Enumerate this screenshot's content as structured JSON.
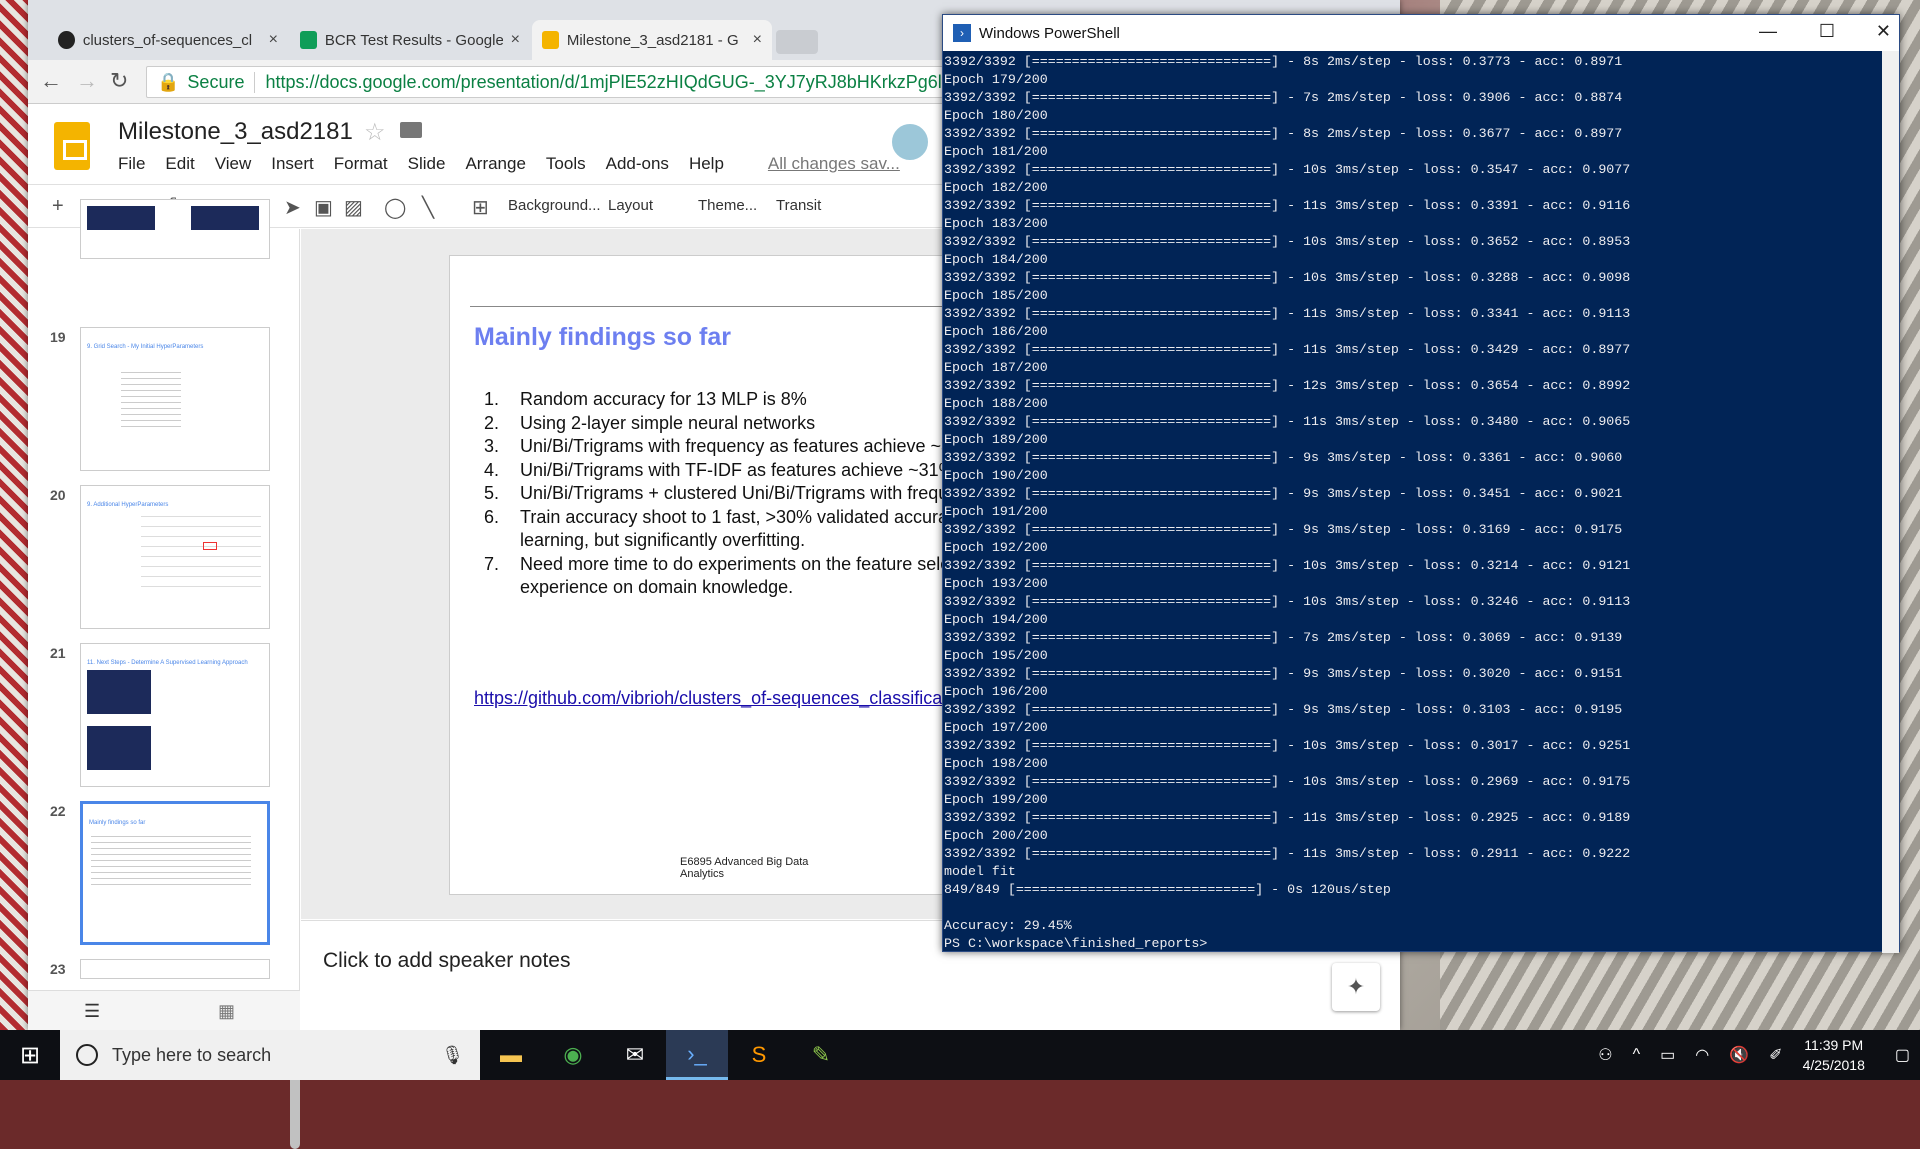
{
  "browser": {
    "tabs": [
      {
        "label": "clusters_of-sequences_cl",
        "close": "×"
      },
      {
        "label": "BCR Test Results - Google",
        "close": "×"
      },
      {
        "label": "Milestone_3_asd2181 - G",
        "close": "×"
      }
    ],
    "secure_label": "Secure",
    "url": "https://docs.google.com/presentation/d/1mjPlE52zHIQdGUG-_3YJ7yRJ8bHKrkzPg6ltTdbw"
  },
  "doc": {
    "title": "Milestone_3_asd2181",
    "menus": [
      "File",
      "Edit",
      "View",
      "Insert",
      "Format",
      "Slide",
      "Arrange",
      "Tools",
      "Add-ons",
      "Help"
    ],
    "saved_status": "All changes sav..."
  },
  "toolbar": {
    "background": "Background...",
    "layout": "Layout",
    "theme": "Theme...",
    "transition": "Transit"
  },
  "filmstrip": {
    "slides": [
      {
        "number": "19",
        "title": "9. Grid Search - My Initial HyperParameters"
      },
      {
        "number": "20",
        "title": "9. Additional HyperParameters"
      },
      {
        "number": "21",
        "title": "11. Next Steps - Determine A Supervised Learning Approach"
      },
      {
        "number": "22",
        "title": "Mainly findings so far"
      },
      {
        "number": "23",
        "title": ""
      }
    ]
  },
  "slide": {
    "title": "Mainly findings so far",
    "items": [
      {
        "n": "1.",
        "text": "Random accuracy for 13 MLP is 8%"
      },
      {
        "n": "2.",
        "text": "Using 2-layer simple neural networks"
      },
      {
        "n": "3.",
        "text": "Uni/Bi/Trigrams with frequency as features achieve ~3"
      },
      {
        "n": "4.",
        "text": "Uni/Bi/Trigrams with TF-IDF as features achieve ~31%"
      },
      {
        "n": "5.",
        "text": "Uni/Bi/Trigrams + clustered Uni/Bi/Trigrams with frequ"
      },
      {
        "n": "6.",
        "text": "Train accuracy shoot to 1 fast, >30% validated accura"
      },
      {
        "n": "",
        "text": "learning, but significantly overfitting."
      },
      {
        "n": "7.",
        "text": "Need more time to do experiments on the feature sele"
      },
      {
        "n": "",
        "text": "experience on domain knowledge."
      }
    ],
    "link": "https://github.com/vibrioh/clusters_of-sequences_classifica",
    "footer": "E6895 Advanced Big Data Analytics"
  },
  "notes": {
    "placeholder": "Click to add speaker notes"
  },
  "powershell": {
    "title": "Windows PowerShell",
    "lines": [
      "3392/3392 [==============================] - 8s 2ms/step - loss: 0.3773 - acc: 0.8971",
      "Epoch 179/200",
      "3392/3392 [==============================] - 7s 2ms/step - loss: 0.3906 - acc: 0.8874",
      "Epoch 180/200",
      "3392/3392 [==============================] - 8s 2ms/step - loss: 0.3677 - acc: 0.8977",
      "Epoch 181/200",
      "3392/3392 [==============================] - 10s 3ms/step - loss: 0.3547 - acc: 0.9077",
      "Epoch 182/200",
      "3392/3392 [==============================] - 11s 3ms/step - loss: 0.3391 - acc: 0.9116",
      "Epoch 183/200",
      "3392/3392 [==============================] - 10s 3ms/step - loss: 0.3652 - acc: 0.8953",
      "Epoch 184/200",
      "3392/3392 [==============================] - 10s 3ms/step - loss: 0.3288 - acc: 0.9098",
      "Epoch 185/200",
      "3392/3392 [==============================] - 11s 3ms/step - loss: 0.3341 - acc: 0.9113",
      "Epoch 186/200",
      "3392/3392 [==============================] - 11s 3ms/step - loss: 0.3429 - acc: 0.8977",
      "Epoch 187/200",
      "3392/3392 [==============================] - 12s 3ms/step - loss: 0.3654 - acc: 0.8992",
      "Epoch 188/200",
      "3392/3392 [==============================] - 11s 3ms/step - loss: 0.3480 - acc: 0.9065",
      "Epoch 189/200",
      "3392/3392 [==============================] - 9s 3ms/step - loss: 0.3361 - acc: 0.9060",
      "Epoch 190/200",
      "3392/3392 [==============================] - 9s 3ms/step - loss: 0.3451 - acc: 0.9021",
      "Epoch 191/200",
      "3392/3392 [==============================] - 9s 3ms/step - loss: 0.3169 - acc: 0.9175",
      "Epoch 192/200",
      "3392/3392 [==============================] - 10s 3ms/step - loss: 0.3214 - acc: 0.9121",
      "Epoch 193/200",
      "3392/3392 [==============================] - 10s 3ms/step - loss: 0.3246 - acc: 0.9113",
      "Epoch 194/200",
      "3392/3392 [==============================] - 7s 2ms/step - loss: 0.3069 - acc: 0.9139",
      "Epoch 195/200",
      "3392/3392 [==============================] - 9s 3ms/step - loss: 0.3020 - acc: 0.9151",
      "Epoch 196/200",
      "3392/3392 [==============================] - 9s 3ms/step - loss: 0.3103 - acc: 0.9195",
      "Epoch 197/200",
      "3392/3392 [==============================] - 10s 3ms/step - loss: 0.3017 - acc: 0.9251",
      "Epoch 198/200",
      "3392/3392 [==============================] - 10s 3ms/step - loss: 0.2969 - acc: 0.9175",
      "Epoch 199/200",
      "3392/3392 [==============================] - 11s 3ms/step - loss: 0.2925 - acc: 0.9189",
      "Epoch 200/200",
      "3392/3392 [==============================] - 11s 3ms/step - loss: 0.2911 - acc: 0.9222",
      "model fit",
      "849/849 [==============================] - 0s 120us/step",
      "",
      "Accuracy: 29.45%",
      "PS C:\\workspace\\finished_reports>"
    ]
  },
  "taskbar": {
    "search_placeholder": "Type here to search",
    "time": "11:39 PM",
    "date": "4/25/2018"
  }
}
